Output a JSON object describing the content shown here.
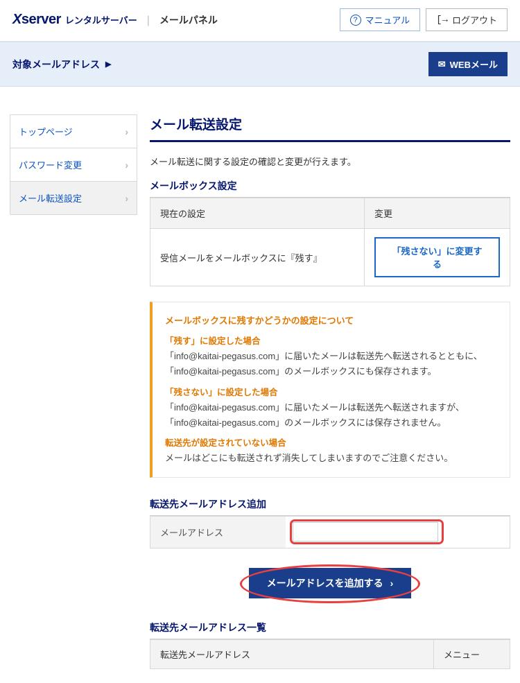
{
  "header": {
    "logo": "Xserver",
    "subtitle": "レンタルサーバー",
    "panel": "メールパネル",
    "manual": "マニュアル",
    "logout": "ログアウト"
  },
  "subbar": {
    "label": "対象メールアドレス",
    "webmail": "WEBメール"
  },
  "sidenav": {
    "items": [
      {
        "label": "トップページ",
        "active": false
      },
      {
        "label": "パスワード変更",
        "active": false
      },
      {
        "label": "メール転送設定",
        "active": true
      }
    ]
  },
  "page": {
    "title": "メール転送設定",
    "desc": "メール転送に関する設定の確認と変更が行えます。"
  },
  "mailbox": {
    "heading": "メールボックス設定",
    "col_current": "現在の設定",
    "col_change": "変更",
    "current_text": "受信メールをメールボックスに『残す』",
    "change_btn": "「残さない」に変更する"
  },
  "info": {
    "title": "メールボックスに残すかどうかの設定について",
    "case1_h": "「残す」に設定した場合",
    "case1_b": "「info@kaitai-pegasus.com」に届いたメールは転送先へ転送されるとともに、「info@kaitai-pegasus.com」のメールボックスにも保存されます。",
    "case2_h": "「残さない」に設定した場合",
    "case2_b": "「info@kaitai-pegasus.com」に届いたメールは転送先へ転送されますが、「info@kaitai-pegasus.com」のメールボックスには保存されません。",
    "case3_h": "転送先が設定されていない場合",
    "case3_b": "メールはどこにも転送されず消失してしまいますのでご注意ください。"
  },
  "add": {
    "heading": "転送先メールアドレス追加",
    "label": "メールアドレス",
    "value": "",
    "submit": "メールアドレスを追加する"
  },
  "list": {
    "heading": "転送先メールアドレス一覧",
    "col_addr": "転送先メールアドレス",
    "col_menu": "メニュー"
  }
}
